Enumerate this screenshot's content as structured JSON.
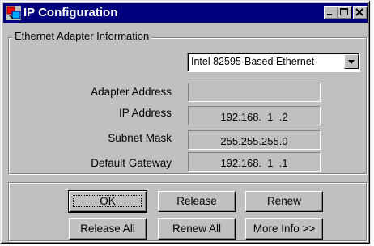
{
  "window": {
    "title": "IP Configuration"
  },
  "group": {
    "label": "Ethernet  Adapter Information"
  },
  "adapter_select": {
    "value": "Intel 82595-Based Ethernet"
  },
  "fields": {
    "adapter_address": {
      "label": "Adapter Address",
      "value": ""
    },
    "ip_address": {
      "label": "IP Address",
      "value": "192.168.  1  .2"
    },
    "subnet_mask": {
      "label": "Subnet Mask",
      "value": "255.255.255.0"
    },
    "default_gateway": {
      "label": "Default Gateway",
      "value": "192.168.  1  .1"
    }
  },
  "buttons": {
    "ok": {
      "label": "OK"
    },
    "release": {
      "label": "Release"
    },
    "renew": {
      "label": "Renew"
    },
    "release_all": {
      "label": "Release All"
    },
    "renew_all": {
      "label": "Renew All"
    },
    "more_info": {
      "label": "More Info >>"
    }
  }
}
